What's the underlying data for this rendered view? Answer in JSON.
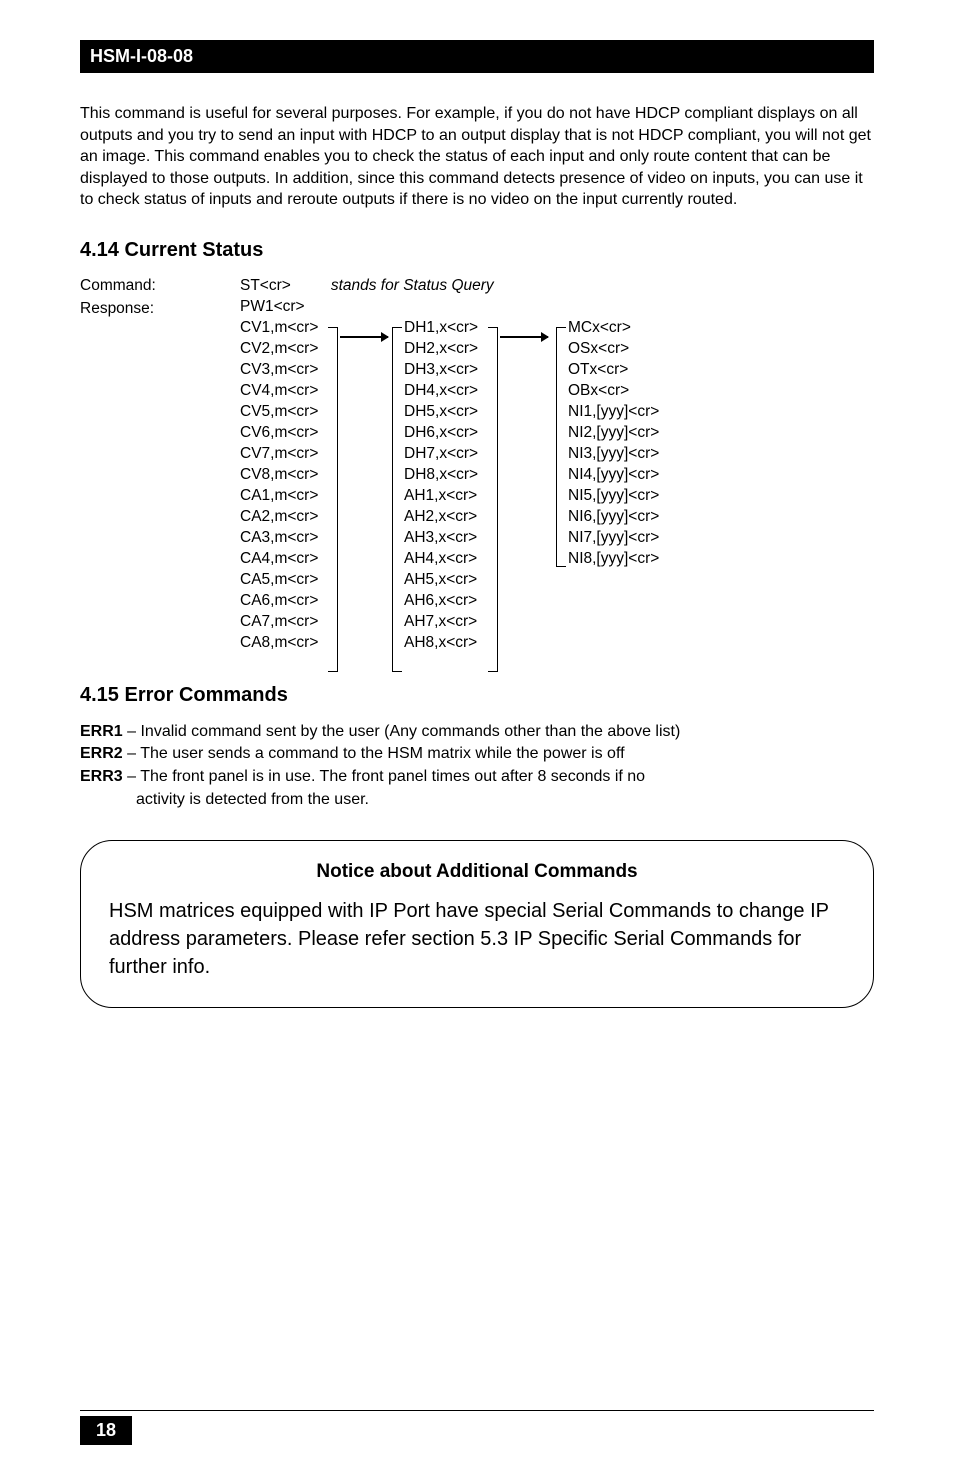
{
  "header": "HSM-I-08-08",
  "intro": "This command is useful for several purposes. For example, if you do not have HDCP compliant displays on all outputs and you try to send an input with HDCP to an output display that is not HDCP compliant, you will not get an image. This command enables you to check the status of each input and only route content that can be displayed to those outputs.  In addition, since this command detects presence of video on inputs, you can use it to check status of inputs and reroute outputs if there is no video on the input currently routed.",
  "section_414": "4.14 Current Status",
  "cmd_label": "Command:",
  "resp_label": "Response:",
  "st": "ST<cr>",
  "st_desc": "stands for Status Query",
  "pw1": "PW1<cr>",
  "col1": [
    "CV1,m<cr>",
    "CV2,m<cr>",
    "CV3,m<cr>",
    "CV4,m<cr>",
    "CV5,m<cr>",
    "CV6,m<cr>",
    "CV7,m<cr>",
    "CV8,m<cr>",
    "CA1,m<cr>",
    "CA2,m<cr>",
    "CA3,m<cr>",
    "CA4,m<cr>",
    "CA5,m<cr>",
    "CA6,m<cr>",
    "CA7,m<cr>",
    "CA8,m<cr>"
  ],
  "col2": [
    "DH1,x<cr>",
    "DH2,x<cr>",
    "DH3,x<cr>",
    "DH4,x<cr>",
    "DH5,x<cr>",
    "DH6,x<cr>",
    "DH7,x<cr>",
    "DH8,x<cr>",
    "AH1,x<cr>",
    "AH2,x<cr>",
    "AH3,x<cr>",
    "AH4,x<cr>",
    "AH5,x<cr>",
    "AH6,x<cr>",
    "AH7,x<cr>",
    "AH8,x<cr>"
  ],
  "col3": [
    "MCx<cr>",
    "OSx<cr>",
    "OTx<cr>",
    "OBx<cr>",
    "NI1,[yyy]<cr>",
    "NI2,[yyy]<cr>",
    "NI3,[yyy]<cr>",
    "NI4,[yyy]<cr>",
    "NI5,[yyy]<cr>",
    "NI6,[yyy]<cr>",
    "NI7,[yyy]<cr>",
    "NI8,[yyy]<cr>"
  ],
  "section_415": "4.15 Error Commands",
  "err1_label": "ERR1",
  "err1_text": " – Invalid command sent by the user (Any commands other than the above list)",
  "err2_label": "ERR2",
  "err2_text": " – The user sends a command to the HSM matrix while the power is off",
  "err3_label": "ERR3",
  "err3_text": " – The front panel is in use. The front panel times out after 8 seconds if no",
  "err3_cont": "activity is detected from the user.",
  "notice_title": "Notice about Additional Commands",
  "notice_body": "HSM matrices equipped with IP Port have special Serial Commands to change IP address parameters. Please refer section 5.3 IP Specific Serial Commands for further info.",
  "page_num": "18"
}
